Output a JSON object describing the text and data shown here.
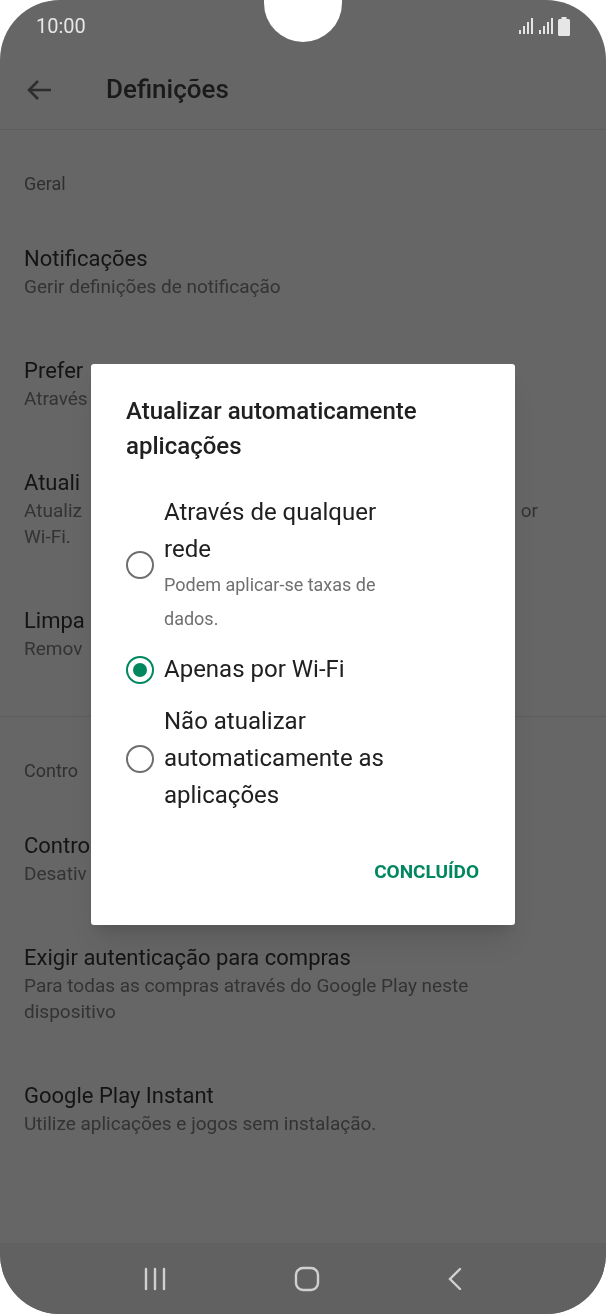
{
  "status_bar": {
    "time": "10:00"
  },
  "header": {
    "title": "Definições"
  },
  "sections": [
    {
      "heading": "Geral",
      "items": [
        {
          "title": "Notificações",
          "subtitle_lines": [
            {
              "text": "Gerir definições de notificação"
            }
          ]
        },
        {
          "title": "Prefer",
          "subtitle_lines": [
            {
              "text": "Através"
            }
          ]
        },
        {
          "title": "Atuali",
          "subtitle_lines": [
            {
              "text": "Atualiz",
              "right": "or"
            },
            {
              "text": "Wi-Fi."
            }
          ]
        },
        {
          "title": "Limpa",
          "subtitle_lines": [
            {
              "text": "Remov"
            }
          ]
        }
      ]
    },
    {
      "heading": "Contro",
      "items": [
        {
          "title": "Contro",
          "subtitle_lines": [
            {
              "text": "Desativ"
            }
          ]
        },
        {
          "title": "Exigir autenticação para compras",
          "subtitle_lines": [
            {
              "text": "Para todas as compras através do Google Play neste"
            },
            {
              "text": "dispositivo"
            }
          ]
        },
        {
          "title": "Google Play Instant",
          "subtitle_lines": [
            {
              "text": "Utilize aplicações e jogos sem instalação."
            }
          ]
        }
      ]
    }
  ],
  "dialog": {
    "title_lines": [
      "Atualizar automaticamente",
      "aplicações"
    ],
    "options": [
      {
        "label_lines": [
          "Através de qualquer",
          "rede"
        ],
        "note_lines": [
          "Podem aplicar-se taxas de",
          "dados."
        ],
        "selected": false
      },
      {
        "label_lines": [
          "Apenas por Wi-Fi"
        ],
        "selected": true
      },
      {
        "label_lines": [
          "Não atualizar",
          "automaticamente as",
          "aplicações"
        ],
        "selected": false
      }
    ],
    "button": "CONCLUÍDO"
  }
}
